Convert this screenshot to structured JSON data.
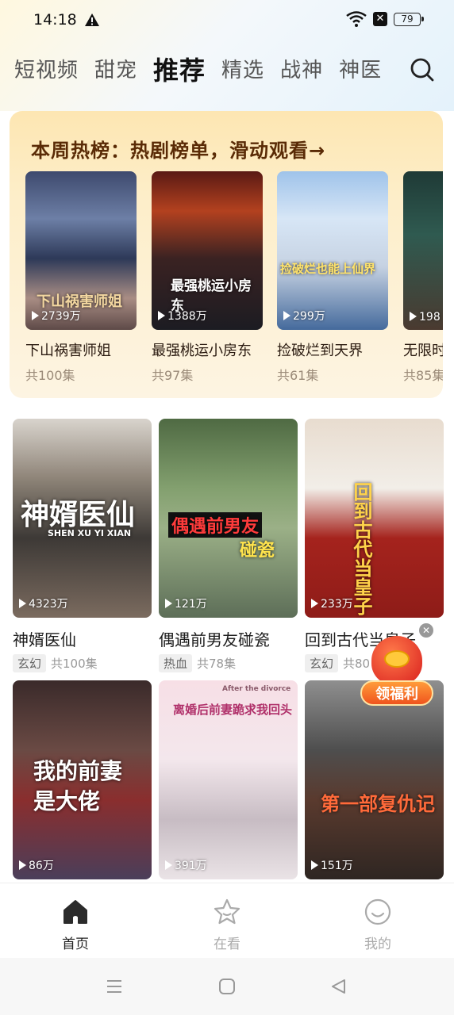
{
  "status_bar": {
    "time": "14:18",
    "battery": "79"
  },
  "categories": [
    {
      "label": "短视频",
      "active": false
    },
    {
      "label": "甜宠",
      "active": false
    },
    {
      "label": "推荐",
      "active": true
    },
    {
      "label": "精选",
      "active": false
    },
    {
      "label": "战神",
      "active": false
    },
    {
      "label": "神医",
      "active": false
    }
  ],
  "hot_section": {
    "title": "本周热榜：热剧榜单，滑动观看→",
    "items": [
      {
        "title": "下山祸害师姐",
        "episodes": "共100集",
        "plays": "2739万",
        "poster_text": "下山祸害师姐"
      },
      {
        "title": "最强桃运小房东",
        "episodes": "共97集",
        "plays": "1388万",
        "poster_text": "最强桃运小房东"
      },
      {
        "title": "捡破烂到天界",
        "episodes": "共61集",
        "plays": "299万",
        "poster_text": "捡破烂也能上仙界"
      },
      {
        "title": "无限时",
        "episodes": "共85集",
        "plays": "198"
      }
    ]
  },
  "grid": [
    {
      "title": "神婿医仙",
      "tag": "玄幻",
      "episodes": "共100集",
      "plays": "4323万",
      "poster_text": "神婿医仙",
      "poster_sub": "SHEN XU YI XIAN"
    },
    {
      "title": "偶遇前男友碰瓷",
      "tag": "热血",
      "episodes": "共78集",
      "plays": "121万",
      "poster_text": "偶遇前男友",
      "poster_sub": "碰瓷"
    },
    {
      "title": "回到古代当皇子",
      "tag": "玄幻",
      "episodes": "共80",
      "plays": "233万",
      "poster_text": "回到古代当皇子"
    },
    {
      "title": "",
      "tag": "",
      "episodes": "",
      "plays": "86万",
      "poster_text": "我的前妻是大佬"
    },
    {
      "title": "",
      "tag": "",
      "episodes": "",
      "plays": "391万",
      "poster_text": "离婚后前妻跪求我回头",
      "poster_sub": "After the divorce"
    },
    {
      "title": "",
      "tag": "",
      "episodes": "",
      "plays": "151万",
      "poster_text": "第一部复仇记"
    }
  ],
  "promo": {
    "label": "领福利"
  },
  "bottom_nav": [
    {
      "label": "首页",
      "icon": "home-icon",
      "active": true
    },
    {
      "label": "在看",
      "icon": "star-icon",
      "active": false
    },
    {
      "label": "我的",
      "icon": "smile-icon",
      "active": false
    }
  ],
  "colors": {
    "hot_title": "#5a2b06",
    "active_tab": "#111111",
    "inactive_tab": "#555555"
  }
}
